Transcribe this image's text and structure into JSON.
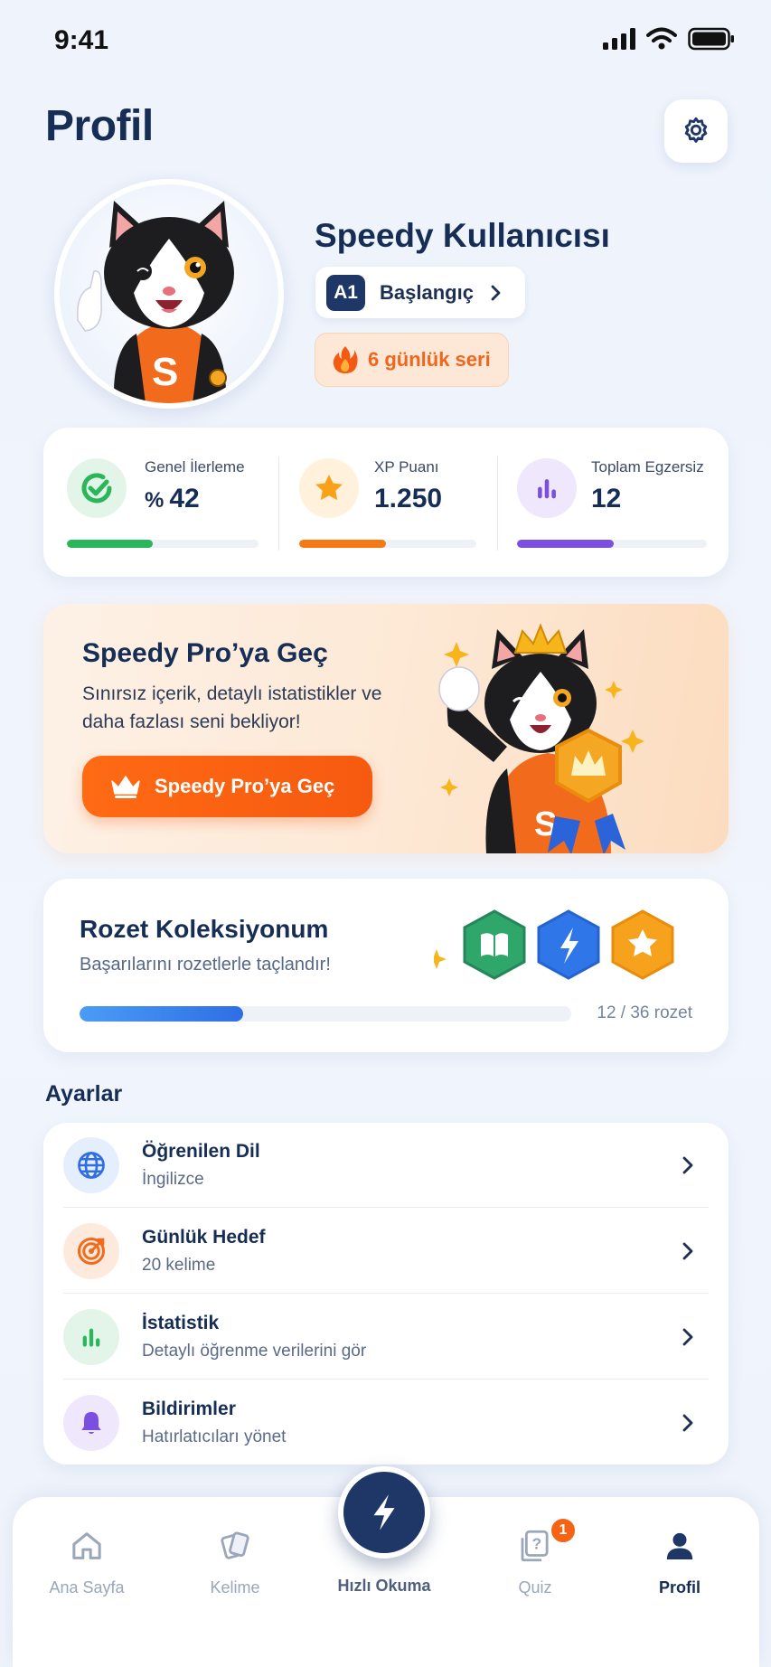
{
  "status_bar": {
    "time": "9:41"
  },
  "header": {
    "title": "Profil"
  },
  "profile": {
    "name": "Speedy Kullanıcısı",
    "level_code": "A1",
    "level_name": "Başlangıç",
    "streak": "6 günlük seri"
  },
  "stats": [
    {
      "label": "Genel İlerleme",
      "prefix": "%",
      "value": "42",
      "progress": 0.45,
      "color": "#2bb65a"
    },
    {
      "label": "XP Puanı",
      "prefix": "",
      "value": "1.250",
      "progress": 0.49,
      "color": "#f57a14"
    },
    {
      "label": "Toplam Egzersiz",
      "prefix": "",
      "value": "12",
      "progress": 0.51,
      "color": "#7b4fe0"
    }
  ],
  "pro": {
    "title": "Speedy Pro’ya Geç",
    "description": "Sınırsız içerik, detaylı istatistikler ve daha fazlası seni bekliyor!",
    "button": "Speedy Pro’ya Geç"
  },
  "badges": {
    "title": "Rozet Koleksiyonum",
    "subtitle": "Başarılarını rozetlerle taçlandır!",
    "count_text": "12 / 36 rozet",
    "earned": 12,
    "total": 36,
    "icons": [
      "book-badge-icon",
      "lightning-badge-icon",
      "star-badge-icon"
    ]
  },
  "settings": {
    "title": "Ayarlar",
    "items": [
      {
        "title": "Öğrenilen Dil",
        "subtitle": "İngilizce",
        "icon": "globe-icon"
      },
      {
        "title": "Günlük Hedef",
        "subtitle": "20 kelime",
        "icon": "target-icon"
      },
      {
        "title": "İstatistik",
        "subtitle": "Detaylı öğrenme verilerini gör",
        "icon": "bar-chart-icon"
      },
      {
        "title": "Bildirimler",
        "subtitle": "Hatırlatıcıları yönet",
        "icon": "bell-icon"
      }
    ]
  },
  "tabs": {
    "home": "Ana Sayfa",
    "words": "Kelime",
    "speed_reading": "Hızlı Okuma",
    "quiz": "Quiz",
    "quiz_badge": "1",
    "profile": "Profil",
    "active": "profile"
  }
}
